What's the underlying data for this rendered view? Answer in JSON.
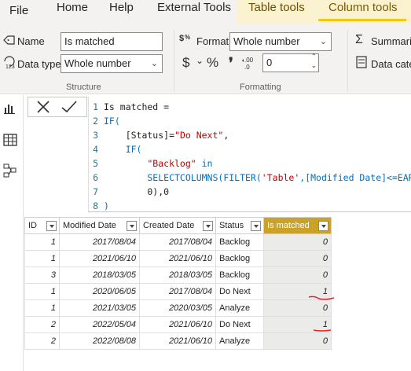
{
  "menu": {
    "tabs": [
      "File",
      "Home",
      "Help",
      "External Tools",
      "Table tools",
      "Column tools"
    ],
    "active_tab": "Column tools"
  },
  "ribbon": {
    "name_label": "Name",
    "name_value": "Is matched",
    "data_type_label": "Data type",
    "data_type_value": "Whole number",
    "structure_label": "Structure",
    "format_label": "Format",
    "format_value": "Whole number",
    "decimals_value": "0",
    "currency_symbol": "$",
    "percent_symbol": "%",
    "comma_symbol": "❜",
    "formatting_label": "Formatting",
    "summarize_label": "Summariz",
    "data_category_label": "Data cate"
  },
  "formula": {
    "lines": [
      {
        "n": "1",
        "parts": [
          {
            "t": "plain",
            "s": "Is matched ="
          }
        ]
      },
      {
        "n": "2",
        "parts": [
          {
            "t": "kw",
            "s": "IF("
          }
        ]
      },
      {
        "n": "3",
        "parts": [
          {
            "t": "plain",
            "s": "    [Status]="
          },
          {
            "t": "str",
            "s": "\"Do Next\""
          },
          {
            "t": "plain",
            "s": ","
          }
        ]
      },
      {
        "n": "4",
        "parts": [
          {
            "t": "kw",
            "s": "    IF("
          }
        ]
      },
      {
        "n": "5",
        "parts": [
          {
            "t": "str",
            "s": "        \"Backlog\""
          },
          {
            "t": "kw",
            "s": " in"
          }
        ]
      },
      {
        "n": "6",
        "parts": [
          {
            "t": "kw",
            "s": "        SELECTCOLUMNS(FILTER("
          },
          {
            "t": "str",
            "s": "'Table'"
          },
          {
            "t": "kw",
            "s": ",[Modified Date]<=EARLIE"
          }
        ]
      },
      {
        "n": "7",
        "parts": [
          {
            "t": "plain",
            "s": "        0),0"
          }
        ]
      },
      {
        "n": "8",
        "parts": [
          {
            "t": "kw",
            "s": ")"
          }
        ]
      }
    ]
  },
  "table": {
    "columns": [
      "ID",
      "Modified Date",
      "Created Date",
      "Status",
      "Is matched"
    ],
    "selected_column": "Is matched",
    "rows": [
      [
        "1",
        "2017/08/04",
        "2017/08/04",
        "Backlog",
        "0"
      ],
      [
        "1",
        "2021/06/10",
        "2021/06/10",
        "Backlog",
        "0"
      ],
      [
        "3",
        "2018/03/05",
        "2018/03/05",
        "Backlog",
        "0"
      ],
      [
        "1",
        "2020/06/05",
        "2017/08/04",
        "Do Next",
        "1"
      ],
      [
        "1",
        "2021/03/05",
        "2020/03/05",
        "Analyze",
        "0"
      ],
      [
        "2",
        "2022/05/04",
        "2021/06/10",
        "Do Next",
        "1"
      ],
      [
        "2",
        "2022/08/08",
        "2021/06/10",
        "Analyze",
        "0"
      ]
    ]
  },
  "colors": {
    "accent": "#f2c811",
    "selected_header": "#c9a227",
    "annotation": "#e8202a"
  },
  "icons": [
    "cancel-icon",
    "commit-icon",
    "report-view-icon",
    "data-view-icon",
    "model-view-icon",
    "summation-icon",
    "data-category-icon"
  ]
}
